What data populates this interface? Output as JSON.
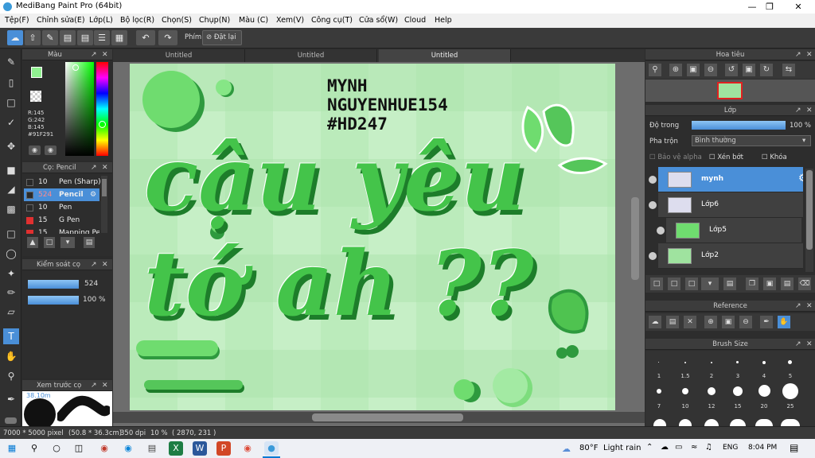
{
  "window": {
    "title": "MediBang Paint Pro (64bit)"
  },
  "menu": [
    "Tệp(F)",
    "Chỉnh sửa(E)",
    "Lớp(L)",
    "Bộ lọc(R)",
    "Chọn(S)",
    "Chụp(N)",
    "Màu (C)",
    "Xem(V)",
    "Công cụ(T)",
    "Cửa sổ(W)",
    "Cloud",
    "Help"
  ],
  "toolbar": {
    "shortcut_label": "Phím",
    "reset_label": "Đặt lại"
  },
  "color_panel": {
    "title": "Màu",
    "r": "R:145",
    "g": "G:242",
    "b": "B:145",
    "hex": "#91F291",
    "fg_color": "#91F291",
    "bg_color": "#ffffff"
  },
  "brush_panel": {
    "title": "Cọ: Pencil",
    "items": [
      {
        "size": "10",
        "name": "Pen (Sharp)",
        "color": "#2a2a2a"
      },
      {
        "size": "524",
        "name": "Pencil",
        "color": "#2a2a2a",
        "selected": true
      },
      {
        "size": "10",
        "name": "Pen",
        "color": "#2a2a2a"
      },
      {
        "size": "15",
        "name": "G Pen",
        "color": "#e03030"
      },
      {
        "size": "15",
        "name": "Mapping Pe",
        "color": "#e03030"
      }
    ]
  },
  "control_panel": {
    "title": "Kiểm soát cọ",
    "size_value": "524",
    "opacity_value": "100 %"
  },
  "preview_panel": {
    "title": "Xem trước cọ",
    "size_text": "38.10m"
  },
  "document_tabs": [
    "Untitled",
    "Untitled",
    "Untitled"
  ],
  "canvas_text": {
    "line1": "MYNH",
    "line2": "NGUYENHUE154",
    "line3": "#HD247",
    "lettering": "cậu yêu tớ ah ??"
  },
  "navigator": {
    "title": "Hoa tiêu"
  },
  "layer_panel": {
    "title": "Lớp",
    "opacity_label": "Độ trong",
    "opacity_value": "100 %",
    "blend_label": "Pha trộn",
    "blend_value": "Bình thường",
    "protect_alpha": "Bảo vệ alpha",
    "clipping": "Xén bớt",
    "lock": "Khóa",
    "layers": [
      {
        "name": "mynh",
        "selected": true
      },
      {
        "name": "Lớp6"
      },
      {
        "name": "Lớp5"
      },
      {
        "name": "Lớp2"
      }
    ]
  },
  "reference_panel": {
    "title": "Reference"
  },
  "brush_size_panel": {
    "title": "Brush Size",
    "sizes": [
      "1",
      "1.5",
      "2",
      "3",
      "4",
      "5",
      "7",
      "10",
      "12",
      "15",
      "20",
      "25"
    ]
  },
  "status": {
    "dimensions": "7000 * 5000 pixel",
    "cm": "(50.8 * 36.3cm)",
    "dpi": "350 dpi",
    "zoom": "10 %",
    "coords": "( 2870, 231 )"
  },
  "taskbar": {
    "temp": "80°F",
    "weather": "Light rain",
    "lang": "ENG",
    "time": "8:04 PM"
  }
}
